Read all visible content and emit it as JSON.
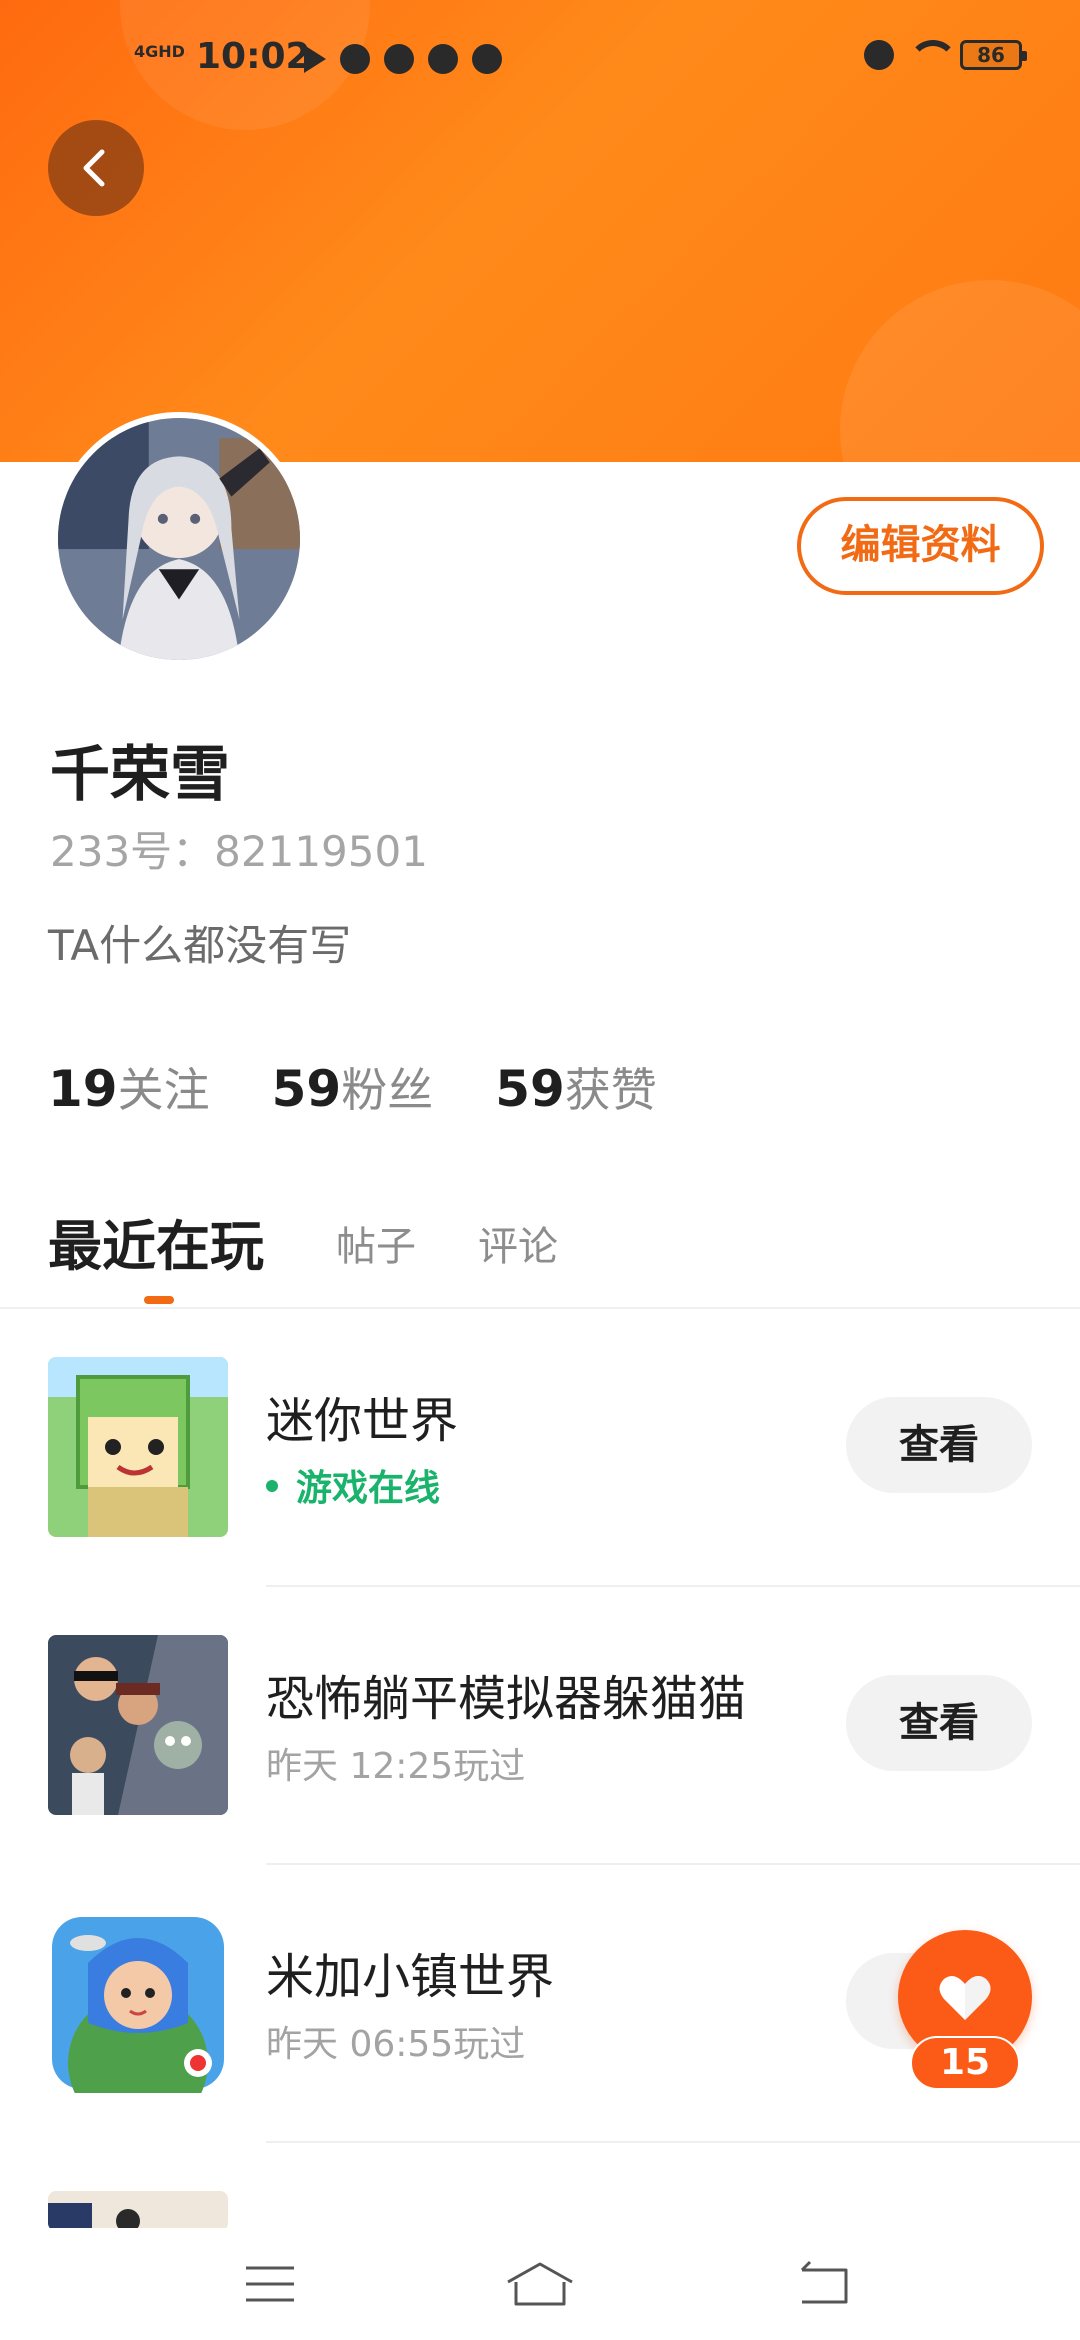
{
  "status_bar": {
    "network": "4GHD",
    "time": "10:02",
    "battery": "86"
  },
  "profile": {
    "name": "千荣雪",
    "uid": "233号：82119501",
    "bio": "TA什么都没有写",
    "edit_label": "编辑资料",
    "stats": [
      {
        "num": "19",
        "label": "关注"
      },
      {
        "num": "59",
        "label": "粉丝"
      },
      {
        "num": "59",
        "label": "获赞"
      }
    ]
  },
  "tabs": [
    "最近在玩",
    "帖子",
    "评论"
  ],
  "games": [
    {
      "title": "迷你世界",
      "sub": "游戏在线",
      "button": "查看"
    },
    {
      "title": "恐怖躺平模拟器躲猫猫",
      "sub": "昨天 12:25玩过",
      "button": "查看"
    },
    {
      "title": "米加小镇世界",
      "sub": "昨天 06:55玩过",
      "button": "查看"
    }
  ],
  "fab": {
    "count": "15"
  },
  "colors": {
    "accent": "#f26a14",
    "online": "#19b36b",
    "header": "#ff7a12"
  }
}
